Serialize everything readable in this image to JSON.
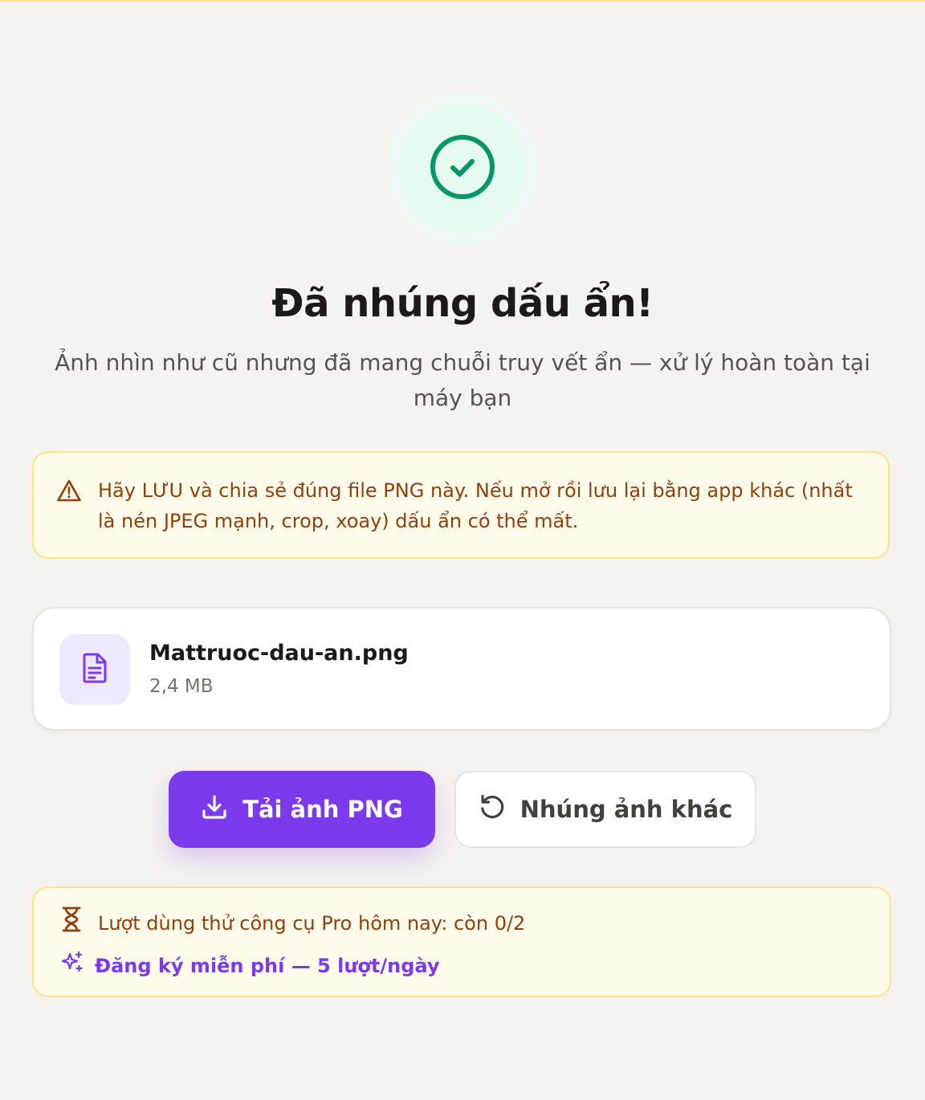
{
  "success": {
    "icon": "check-circle-icon",
    "title": "Đã nhúng dấu ẩn!",
    "subtitle": "Ảnh nhìn như cũ nhưng đã mang chuỗi truy vết ẩn — xử lý hoàn toàn tại máy bạn"
  },
  "warning": {
    "icon": "alert-triangle-icon",
    "text": "Hãy LƯU và chia sẻ đúng file PNG này. Nếu mở rồi lưu lại bằng app khác (nhất là nén JPEG mạnh, crop, xoay) dấu ẩn có thể mất."
  },
  "file": {
    "icon": "file-text-icon",
    "name": "Mattruoc-dau-an.png",
    "size": "2,4 MB"
  },
  "actions": {
    "download_label": "Tải ảnh PNG",
    "download_icon": "download-icon",
    "reset_label": "Nhúng ảnh khác",
    "reset_icon": "rotate-ccw-icon"
  },
  "quota": {
    "icon": "hourglass-icon",
    "text": "Lượt dùng thử công cụ Pro hôm nay: còn 0/2",
    "signup_icon": "sparkles-icon",
    "signup_label": "Đăng ký miễn phí — 5 lượt/ngày"
  },
  "colors": {
    "background": "#f5f3ef",
    "accent": "#7c3aed",
    "success": "#059669",
    "warning_bg": "#fefbea",
    "warning_border": "#fde68a",
    "warning_text": "#92400e"
  }
}
